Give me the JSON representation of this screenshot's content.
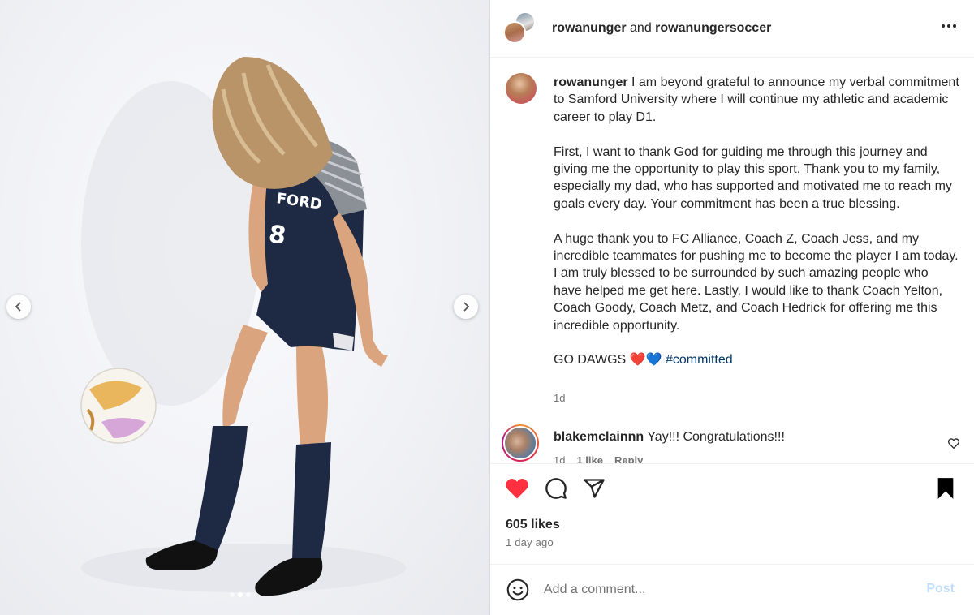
{
  "header": {
    "user1": "rowanunger",
    "joiner": "and",
    "user2": "rowanungersoccer"
  },
  "caption": {
    "username": "rowanunger",
    "paragraph1": "I am beyond grateful to announce my verbal commitment to Samford University where I will continue my athletic and academic career to play D1.",
    "paragraph2": "First, I want to thank God for guiding me through this journey and giving me the opportunity to play this sport. Thank you to my family, especially my dad, who has supported and motivated me to reach my goals every day. Your commitment has been a true blessing.",
    "paragraph3": "A huge thank you to FC Alliance, Coach Z, Coach Jess, and my incredible teammates for pushing me to become the player I am today. I am truly blessed to be surrounded by such amazing people who have helped me get here. Lastly, I would like to thank Coach Yelton, Coach Goody, Coach Metz, and Coach Hedrick for offering me this incredible opportunity.",
    "closing": "GO DAWGS ❤️💙",
    "hashtag": "#committed",
    "age": "1d"
  },
  "comment": {
    "username": "blakemclainnn",
    "text": "Yay!!! Congratulations!!!",
    "age": "1d",
    "likes": "1 like",
    "reply": "Reply"
  },
  "stats": {
    "likes": "605 likes",
    "time": "1 day ago"
  },
  "compose": {
    "placeholder": "Add a comment...",
    "post": "Post"
  },
  "media": {
    "jersey_number": "8",
    "jersey_text": "FORD"
  },
  "colors": {
    "like_red": "#ff3040",
    "link_blue": "#00376b",
    "post_disabled": "#c0dffd",
    "jersey_navy": "#1e2a44"
  },
  "icons": [
    "chevron-left-icon",
    "chevron-right-icon",
    "more-icon",
    "heart-icon",
    "comment-icon",
    "share-icon",
    "bookmark-icon",
    "emoji-icon"
  ]
}
